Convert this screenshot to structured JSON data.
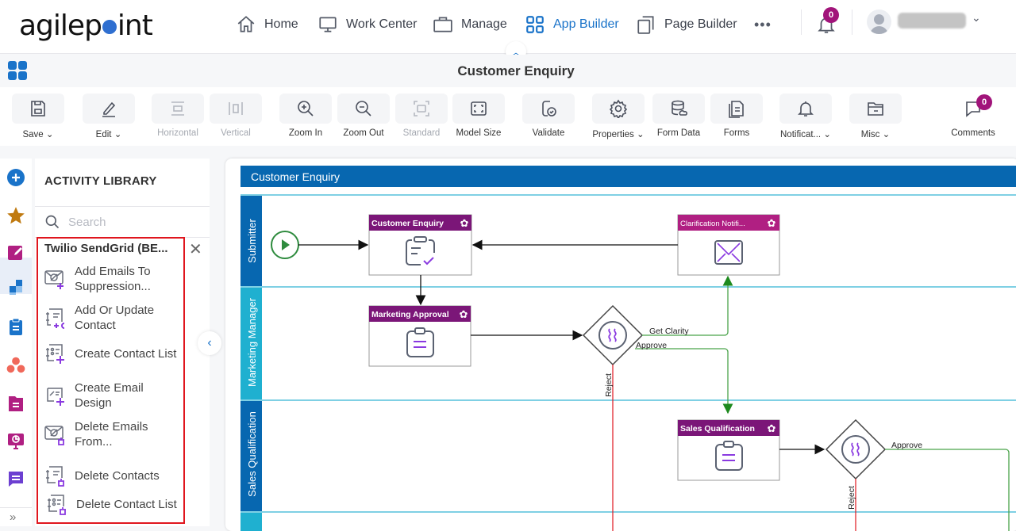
{
  "app": {
    "logo_text_a": "agilep",
    "logo_text_b": "int"
  },
  "nav": {
    "items": [
      {
        "label": "Home",
        "icon": "home-icon"
      },
      {
        "label": "Work Center",
        "icon": "monitor-icon"
      },
      {
        "label": "Manage",
        "icon": "briefcase-icon"
      },
      {
        "label": "App Builder",
        "icon": "grid-icon",
        "active": true
      },
      {
        "label": "Page Builder",
        "icon": "copy-icon"
      }
    ],
    "more": "•••",
    "notification_count": "0"
  },
  "header": {
    "title": "Customer Enquiry"
  },
  "toolbar": {
    "items": [
      {
        "label": "Save",
        "dropdown": true
      },
      {
        "label": "Edit",
        "dropdown": true
      },
      {
        "label": "Horizontal",
        "disabled": true
      },
      {
        "label": "Vertical",
        "disabled": true
      },
      {
        "label": "Zoom In"
      },
      {
        "label": "Zoom Out"
      },
      {
        "label": "Standard",
        "disabled": true
      },
      {
        "label": "Model Size"
      },
      {
        "label": "Validate"
      },
      {
        "label": "Properties",
        "dropdown": true
      },
      {
        "label": "Form Data"
      },
      {
        "label": "Forms"
      },
      {
        "label": "Notificat...",
        "dropdown": true
      },
      {
        "label": "Misc",
        "dropdown": true
      },
      {
        "label": "Comments",
        "badge": "0"
      }
    ]
  },
  "library": {
    "title": "ACTIVITY LIBRARY",
    "search_placeholder": "Search",
    "group": "Twilio SendGrid (BE...",
    "activities": [
      "Add Emails To Suppression...",
      "Add Or Update Contact",
      "Create Contact List",
      "Create Email Design",
      "Delete Emails From...",
      "Delete Contacts",
      "Delete Contact List"
    ],
    "collapse_glyph": "‹",
    "expand_glyph": "»"
  },
  "diagram": {
    "pool_title": "Customer Enquiry",
    "lanes": [
      "Submitter",
      "Marketing Manager",
      "Sales Qualification"
    ],
    "tasks": [
      {
        "title": "Customer Enquiry",
        "icon": "clipboard-check-icon"
      },
      {
        "title": "Clarification Notifi...",
        "icon": "envelope-icon"
      },
      {
        "title": "Marketing Approval",
        "icon": "clipboard-list-icon"
      },
      {
        "title": "Sales Qualification",
        "icon": "clipboard-list-icon"
      }
    ],
    "labels": {
      "get_clarity": "Get Clarity",
      "approve": "Approve",
      "reject": "Reject"
    },
    "colors": {
      "pool": "#0767b0",
      "lane_alt": "#1fb0d0",
      "task_header": "#7b1678",
      "task_header_alt": "#b01f82",
      "flow_green": "#2e8b2e",
      "flow_red": "#e0161e"
    }
  }
}
